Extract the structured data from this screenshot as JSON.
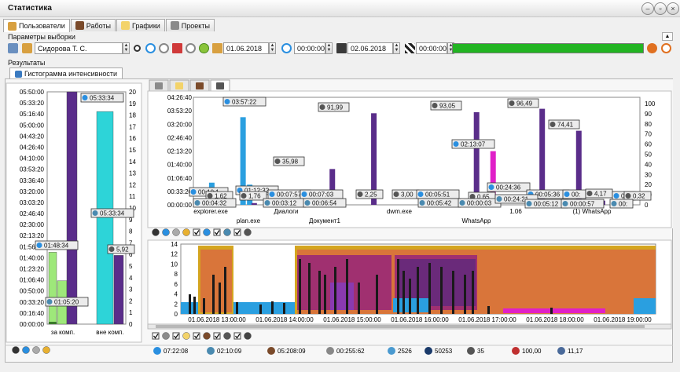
{
  "window": {
    "title": "Статистика"
  },
  "tabs": [
    {
      "label": "Пользователи",
      "icon": "users-icon"
    },
    {
      "label": "Работы",
      "icon": "hammer-icon"
    },
    {
      "label": "Графики",
      "icon": "folder-icon"
    },
    {
      "label": "Проекты",
      "icon": "network-icon"
    }
  ],
  "params": {
    "label": "Параметры выборки",
    "user": "Сидорова Т. С.",
    "date_from": "01.06.2018",
    "time_from": "00:00:00",
    "date_to": "02.06.2018",
    "time_to": "00:00:00",
    "progress": 1.0
  },
  "results": {
    "label": "Результаты",
    "tab": "Гистограмма интенсивности"
  },
  "colors": {
    "purple": "#5a2d8a",
    "cyan": "#2dd4d8",
    "light_green": "#9ee87a",
    "blue": "#2a9fe0",
    "magenta": "#e020c8",
    "dark": "#1a1a1a",
    "orange": "#d9753a",
    "plum": "#a03070",
    "gold": "#d4a520",
    "progress": "#22b422"
  },
  "left_chart": {
    "y_ticks": [
      "05:50:00",
      "05:33:20",
      "05:16:40",
      "05:00:00",
      "04:43:20",
      "04:26:40",
      "04:10:00",
      "03:53:20",
      "03:36:40",
      "03:20:00",
      "03:03:20",
      "02:46:40",
      "02:30:00",
      "02:13:20",
      "01:56:40",
      "01:40:00",
      "01:23:20",
      "01:06:40",
      "00:50:00",
      "00:33:20",
      "00:16:40",
      "00:00:00"
    ],
    "y2_ticks": [
      "20",
      "19",
      "18",
      "17",
      "16",
      "15",
      "14",
      "13",
      "12",
      "11",
      "10",
      "9",
      "8",
      "7",
      "6",
      "5",
      "4",
      "3",
      "2",
      "1",
      "0"
    ],
    "categories": [
      "за комп.",
      "вне комп."
    ],
    "bars": [
      {
        "series": "active",
        "category": 0,
        "seconds": 6500,
        "color": "#9ee87a"
      },
      {
        "series": "idle",
        "category": 0,
        "seconds": 3920,
        "color": "#9ee87a"
      },
      {
        "series": "activity",
        "category": 0,
        "value": 20,
        "color": "#5a2d8a"
      },
      {
        "series": "away",
        "category": 1,
        "seconds": 19220,
        "color": "#2dd4d8"
      },
      {
        "series": "count",
        "category": 1,
        "value": 5.92,
        "color": "#5a2d8a"
      }
    ],
    "labels": [
      {
        "text": "05:33:34",
        "kind": "pin"
      },
      {
        "text": "05:33:34",
        "kind": "net"
      },
      {
        "text": "01:48:34",
        "kind": "pin"
      },
      {
        "text": "5,92",
        "kind": "clock"
      },
      {
        "text": "01:05:20",
        "kind": "net"
      }
    ]
  },
  "top_chart": {
    "sub_tabs": [
      "network-icon",
      "folder-icon",
      "hammer-icon",
      "cube-icon"
    ],
    "y_ticks": [
      "04:26:40",
      "03:53:20",
      "03:20:00",
      "02:46:40",
      "02:13:20",
      "01:40:00",
      "01:06:40",
      "00:33:20",
      "00:00:00"
    ],
    "y2_ticks": [
      "100",
      "90",
      "80",
      "70",
      "60",
      "50",
      "40",
      "30",
      "20",
      "10",
      "0"
    ],
    "categories_top": [
      "explorer.exe",
      "Диалоги",
      "dwm.exe",
      "1.06",
      "(1) WhatsApp"
    ],
    "categories_bottom": [
      "plan.exe",
      "Документ1",
      "WhatsApp"
    ],
    "bars": [
      {
        "x": 0.035,
        "seconds": 3300,
        "color": "#2a9fe0"
      },
      {
        "x": 0.042,
        "seconds": 60,
        "color": "#5a2d8a"
      },
      {
        "x": 0.105,
        "seconds": 13042,
        "color": "#2a9fe0"
      },
      {
        "x": 0.12,
        "seconds": 3000,
        "color": "#2a9fe0"
      },
      {
        "x": 0.13,
        "value": 1.76,
        "color": "#5a2d8a"
      },
      {
        "x": 0.305,
        "value": 35.98,
        "color": "#5a2d8a"
      },
      {
        "x": 0.398,
        "value": 91.99,
        "color": "#5a2d8a"
      },
      {
        "x": 0.552,
        "value": 3.0,
        "color": "#5a2d8a"
      },
      {
        "x": 0.605,
        "seconds": 331,
        "color": "#2a9fe0"
      },
      {
        "x": 0.628,
        "value": 93.05,
        "color": "#5a2d8a"
      },
      {
        "x": 0.665,
        "seconds": 7987,
        "color": "#e020c8"
      },
      {
        "x": 0.772,
        "seconds": 1471,
        "color": "#2a9fe0"
      },
      {
        "x": 0.775,
        "value": 96.49,
        "color": "#5a2d8a"
      },
      {
        "x": 0.857,
        "value": 74.41,
        "color": "#5a2d8a"
      },
      {
        "x": 0.91,
        "value": 4.17,
        "color": "#5a2d8a"
      }
    ],
    "labels": [
      {
        "text": "03:57:22",
        "kind": "pin"
      },
      {
        "text": "91,99",
        "kind": "clock"
      },
      {
        "text": "35,98",
        "kind": "clock"
      },
      {
        "text": "93,05",
        "kind": "clock"
      },
      {
        "text": "96,49",
        "kind": "clock"
      },
      {
        "text": "02:13:07",
        "kind": "pin"
      },
      {
        "text": "74,41",
        "kind": "clock"
      },
      {
        "text": "00:10:1",
        "kind": "pin"
      },
      {
        "text": "1,62",
        "kind": "clock"
      },
      {
        "text": "01:12:32",
        "kind": "pin"
      },
      {
        "text": "1,76",
        "kind": "clock"
      },
      {
        "text": "00:07:57",
        "kind": "pin"
      },
      {
        "text": "00:07:03",
        "kind": "pin"
      },
      {
        "text": "2,25",
        "kind": "clock"
      },
      {
        "text": "3,00",
        "kind": "clock"
      },
      {
        "text": "00:05:51",
        "kind": "pin"
      },
      {
        "text": "00:24:36",
        "kind": "pin"
      },
      {
        "text": "0,65",
        "kind": "clock"
      },
      {
        "text": "00:05:36",
        "kind": "pin"
      },
      {
        "text": "00:",
        "kind": "pin"
      },
      {
        "text": "4,17",
        "kind": "clock"
      },
      {
        "text": "00:",
        "kind": "pin"
      },
      {
        "text": "0,32",
        "kind": "clock"
      },
      {
        "text": "00:04:32",
        "kind": "net"
      },
      {
        "text": "00:03:12",
        "kind": "net"
      },
      {
        "text": "00:06:54",
        "kind": "net"
      },
      {
        "text": "00:05:42",
        "kind": "net"
      },
      {
        "text": "00:00:03",
        "kind": "net"
      },
      {
        "text": "00:24:21",
        "kind": "net"
      },
      {
        "text": "00:05:12",
        "kind": "net"
      },
      {
        "text": "00:00:57",
        "kind": "net"
      },
      {
        "text": "00:",
        "kind": "net"
      }
    ]
  },
  "timeline": {
    "y_ticks": [
      "14",
      "12",
      "10",
      "8",
      "6",
      "4",
      "2",
      "0"
    ],
    "x_ticks": [
      "01.06.2018 13:00:00",
      "01.06.2018 14:00:00",
      "01.06.2018 15:00:00",
      "01.06.2018 16:00:00",
      "01.06.2018 17:00:00",
      "01.06.2018 18:00:00",
      "01.06.2018 19:00:00"
    ]
  },
  "status_bar": [
    {
      "icon": "pin-icon",
      "text": "07:22:08"
    },
    {
      "icon": "network-icon",
      "text": "02:10:09"
    },
    {
      "icon": "hammer-icon",
      "text": "05:208:09"
    },
    {
      "icon": "clock-icon",
      "text": "00:255:62"
    },
    {
      "icon": "users-icon",
      "text": "2526"
    },
    {
      "icon": "keyboard-icon",
      "text": "50253"
    },
    {
      "icon": "transfer-icon",
      "text": "35"
    },
    {
      "icon": "gauge-icon",
      "text": "100,00"
    },
    {
      "icon": "globe-icon",
      "text": "11,17"
    }
  ]
}
